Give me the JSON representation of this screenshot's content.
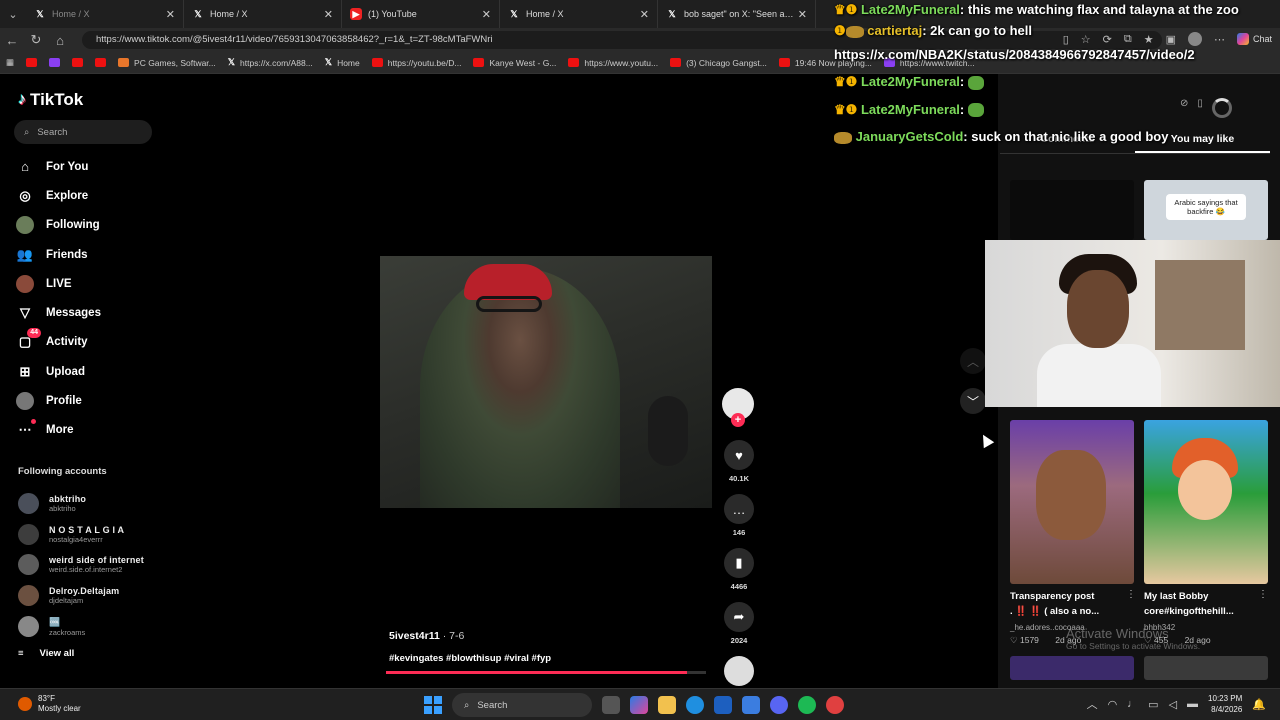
{
  "browser": {
    "tabs": [
      {
        "title": "Home / X",
        "icon": "x-icon"
      },
      {
        "title": "Home / X",
        "icon": "x-icon"
      },
      {
        "title": "(1) YouTube",
        "icon": "youtube-icon"
      },
      {
        "title": "Home / X",
        "icon": "x-icon"
      },
      {
        "title": "bob saget\" on X: \"Seen a fat stud",
        "icon": "x-icon"
      }
    ],
    "url": "https://www.tiktok.com/@5ivest4r11/video/7659313047063858462?_r=1&_t=ZT-98cMTaFWNri",
    "chat_label": "Chat",
    "bookmarks": [
      {
        "label": "PC Games, Softwar...",
        "color": "#e8762b"
      },
      {
        "label": "https://x.com/A88...",
        "color": "x"
      },
      {
        "label": "Home",
        "color": "x"
      },
      {
        "label": "https://youtu.be/D...",
        "color": "#e11111"
      },
      {
        "label": "Kanye West - G...",
        "color": "#e11111"
      },
      {
        "label": "https://www.youtu...",
        "color": "#e11111"
      },
      {
        "label": "(3) Chicago Gangst...",
        "color": "#e11111"
      },
      {
        "label": "19:46 Now playing...",
        "color": "#e11111"
      },
      {
        "label": "https://www.twitch...",
        "color": "#8a3ff2"
      }
    ]
  },
  "tiktok": {
    "logo": "TikTok",
    "search_placeholder": "Search",
    "nav": [
      {
        "label": "For You",
        "icon": "home-icon"
      },
      {
        "label": "Explore",
        "icon": "compass-icon"
      },
      {
        "label": "Following",
        "icon": "following-avatar-icon"
      },
      {
        "label": "Friends",
        "icon": "friends-icon"
      },
      {
        "label": "LIVE",
        "icon": "live-avatar-icon"
      },
      {
        "label": "Messages",
        "icon": "messages-icon"
      },
      {
        "label": "Activity",
        "icon": "activity-icon",
        "badge": "44"
      },
      {
        "label": "Upload",
        "icon": "upload-icon"
      },
      {
        "label": "Profile",
        "icon": "profile-avatar-icon"
      },
      {
        "label": "More",
        "icon": "more-icon"
      }
    ],
    "following_title": "Following accounts",
    "following": [
      {
        "name": "abktriho",
        "handle": "abktriho"
      },
      {
        "name": "N O S T A L G I A",
        "handle": "nostalgia4everrr"
      },
      {
        "name": "weird side of internet",
        "handle": "weird.side.of.internet2"
      },
      {
        "name": "Delroy.Deltajam",
        "handle": "djdeltajam"
      },
      {
        "name": "🆒",
        "handle": "zackroams"
      }
    ],
    "view_all": "View all",
    "video": {
      "username": "5ivest4r11",
      "date": "· 7-6",
      "hashtags": "#kevingates #blowthisup #viral #fyp",
      "progress_fraction": 0.94,
      "likes": "40.1K",
      "comments": "146",
      "saves": "4466",
      "shares": "2024"
    },
    "right_panel": {
      "tabs": [
        "Comments",
        "You may like"
      ],
      "active_tab": "You may like",
      "thumb_overlay_text": "Arabic sayings that backfire 😂",
      "cards": [
        {
          "title": "Transparency post",
          "subtitle": ". ‼️ ‼️ ( also a no...",
          "author": "_he.adores..cocoaaa",
          "likes": "1579",
          "age": "2d ago"
        },
        {
          "title": "My last Bobby",
          "subtitle": "core#kingofthehill...",
          "author": "bhbh342",
          "likes": "455",
          "age": "2d ago"
        }
      ]
    }
  },
  "stream_chat": [
    {
      "user": "Late2MyFuneral",
      "message": "this me watching flax and talayna at the zoo",
      "color": "#7ddb5b",
      "badges": "crown"
    },
    {
      "user": "cartiertaj",
      "message": "2k can go to hell",
      "color": "#e6c02a",
      "badges": "crown"
    },
    {
      "user": "",
      "message": "https://x.com/NBA2K/status/2084384966792847457/video/2",
      "color": "#ffffff",
      "badges": ""
    },
    {
      "user": "Late2MyFuneral",
      "message": "",
      "color": "#7ddb5b",
      "badges": "crown"
    },
    {
      "user": "Late2MyFuneral",
      "message": "",
      "color": "#7ddb5b",
      "badges": "crown"
    },
    {
      "user": "JanuaryGetsCold",
      "message": "suck on that nic like a good boy",
      "color": "#7ddb5b",
      "badges": "frog"
    }
  ],
  "watermark": {
    "line1": "Activate Windows",
    "line2": "Go to Settings to activate Windows."
  },
  "taskbar": {
    "temp": "83°F",
    "weather": "Mostly clear",
    "search": "Search",
    "time": "10:23 PM",
    "date": "8/4/2026"
  }
}
